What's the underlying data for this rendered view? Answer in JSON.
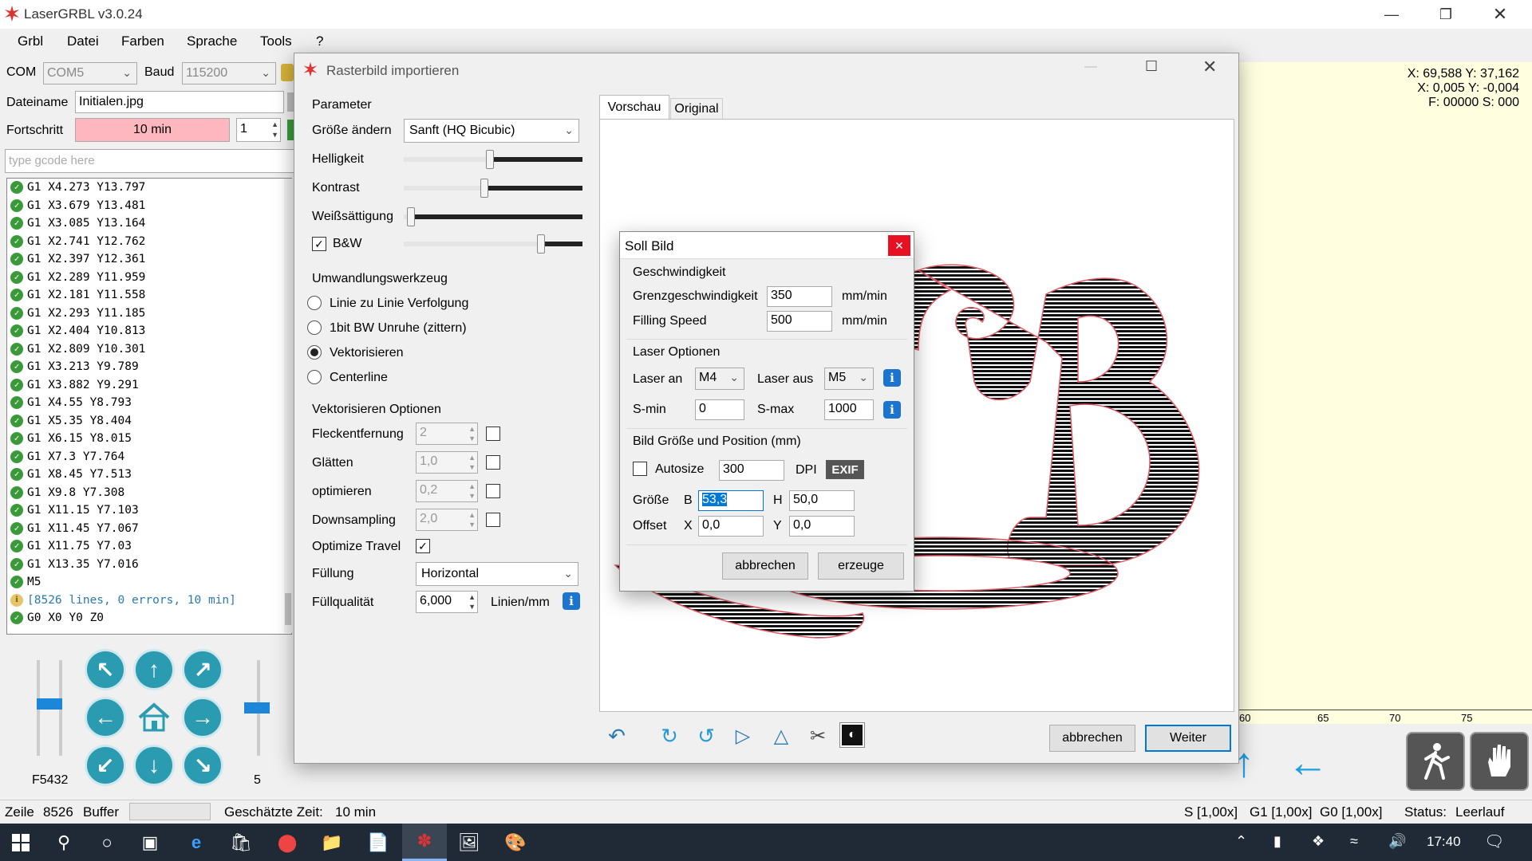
{
  "app": {
    "title": "LaserGRBL v3.0.24",
    "menu": [
      "Grbl",
      "Datei",
      "Farben",
      "Sprache",
      "Tools",
      "?"
    ]
  },
  "connection": {
    "com_label": "COM",
    "com_value": "COM5",
    "baud_label": "Baud",
    "baud_value": "115200"
  },
  "file": {
    "name_label": "Dateiname",
    "name_value": "Initialen.jpg",
    "progress_label": "Fortschritt",
    "progress_value": "10 min",
    "repeat_value": "1",
    "gcode_placeholder": "type gcode here"
  },
  "gcode_lines": [
    "G1 X4.273 Y13.797",
    "G1 X3.679 Y13.481",
    "G1 X3.085 Y13.164",
    "G1 X2.741 Y12.762",
    "G1 X2.397 Y12.361",
    "G1 X2.289 Y11.959",
    "G1 X2.181 Y11.558",
    "G1 X2.293 Y11.185",
    "G1 X2.404 Y10.813",
    "G1 X2.809 Y10.301",
    "G1 X3.213 Y9.789",
    "G1 X3.882 Y9.291",
    "G1 X4.55 Y8.793",
    "G1 X5.35 Y8.404",
    "G1 X6.15 Y8.015",
    "G1 X7.3 Y7.764",
    "G1 X8.45 Y7.513",
    "G1 X9.8 Y7.308",
    "G1 X11.15 Y7.103",
    "G1 X11.45 Y7.067",
    "G1 X11.75 Y7.03",
    "G1 X13.35 Y7.016",
    "M5"
  ],
  "gcode_summary": "[8526 lines, 0 errors, 10 min]",
  "gcode_last": "G0 X0 Y0 Z0",
  "jog": {
    "feed_label": "F5432",
    "step_label": "5",
    "feed_level": 0.55,
    "step_level": 0.5
  },
  "position": {
    "line1": "X: 69,588 Y: 37,162",
    "line2": "X: 0,005 Y: -0,004",
    "line3": "F: 00000 S: 000"
  },
  "ruler": [
    "60",
    "65",
    "70",
    "75"
  ],
  "statusbar": {
    "line_label": "Zeile",
    "line_value": "8526",
    "buffer_label": "Buffer",
    "time_label": "Geschätzte Zeit:",
    "time_value": "10 min",
    "s_override": "S [1,00x]",
    "g1_override": "G1 [1,00x]",
    "g0_override": "G0 [1,00x]",
    "status_label": "Status:",
    "status_value": "Leerlauf"
  },
  "taskbar": {
    "time": "17:40"
  },
  "import_dialog": {
    "title": "Rasterbild importieren",
    "params_title": "Parameter",
    "resize_label": "Größe ändern",
    "resize_value": "Sanft (HQ Bicubic)",
    "brightness_label": "Helligkeit",
    "brightness_level": 0.48,
    "contrast_label": "Kontrast",
    "contrast_level": 0.45,
    "whiteclip_label": "Weißsättigung",
    "whiteclip_level": 0.02,
    "bw_label": "B&W",
    "bw_level": 0.78,
    "tool_title": "Umwandlungswerkzeug",
    "tools": [
      "Linie zu Linie Verfolgung",
      "1bit BW Unruhe (zittern)",
      "Vektorisieren",
      "Centerline"
    ],
    "selected_tool": 2,
    "vec_title": "Vektorisieren Optionen",
    "vec_options": [
      {
        "label": "Fleckentfernung",
        "value": "2"
      },
      {
        "label": "Glätten",
        "value": "1,0"
      },
      {
        "label": "optimieren",
        "value": "0,2"
      },
      {
        "label": "Downsampling",
        "value": "2,0"
      }
    ],
    "optimize_travel_label": "Optimize Travel",
    "fill_label": "Füllung",
    "fill_value": "Horizontal",
    "fill_quality_label": "Füllqualität",
    "fill_quality_value": "6,000",
    "fill_quality_unit": "Linien/mm",
    "tab_preview": "Vorschau",
    "tab_original": "Original",
    "cancel_label": "abbrechen",
    "next_label": "Weiter"
  },
  "soll_dialog": {
    "title": "Soll Bild",
    "speed_title": "Geschwindigkeit",
    "border_speed_label": "Grenzgeschwindigkeit",
    "border_speed_value": "350",
    "fill_speed_label": "Filling Speed",
    "fill_speed_value": "500",
    "speed_unit": "mm/min",
    "laser_title": "Laser Optionen",
    "laser_on_label": "Laser an",
    "laser_on_value": "M4",
    "laser_off_label": "Laser aus",
    "laser_off_value": "M5",
    "smin_label": "S-min",
    "smin_value": "0",
    "smax_label": "S-max",
    "smax_value": "1000",
    "size_title": "Bild Größe und Position (mm)",
    "autosize_label": "Autosize",
    "dpi_value": "300",
    "dpi_label": "DPI",
    "exif_label": "EXIF",
    "size_label": "Größe",
    "w_label": "B",
    "w_value": "53,3",
    "h_label": "H",
    "h_value": "50,0",
    "offset_label": "Offset",
    "x_label": "X",
    "x_value": "0,0",
    "y_label": "Y",
    "y_value": "0,0",
    "cancel_label": "abbrechen",
    "create_label": "erzeuge"
  },
  "colors": {
    "accent": "#0078d7",
    "jog": "#2a9bb0",
    "progress": "#ffb7bf",
    "canvas": "#ffffe0"
  }
}
